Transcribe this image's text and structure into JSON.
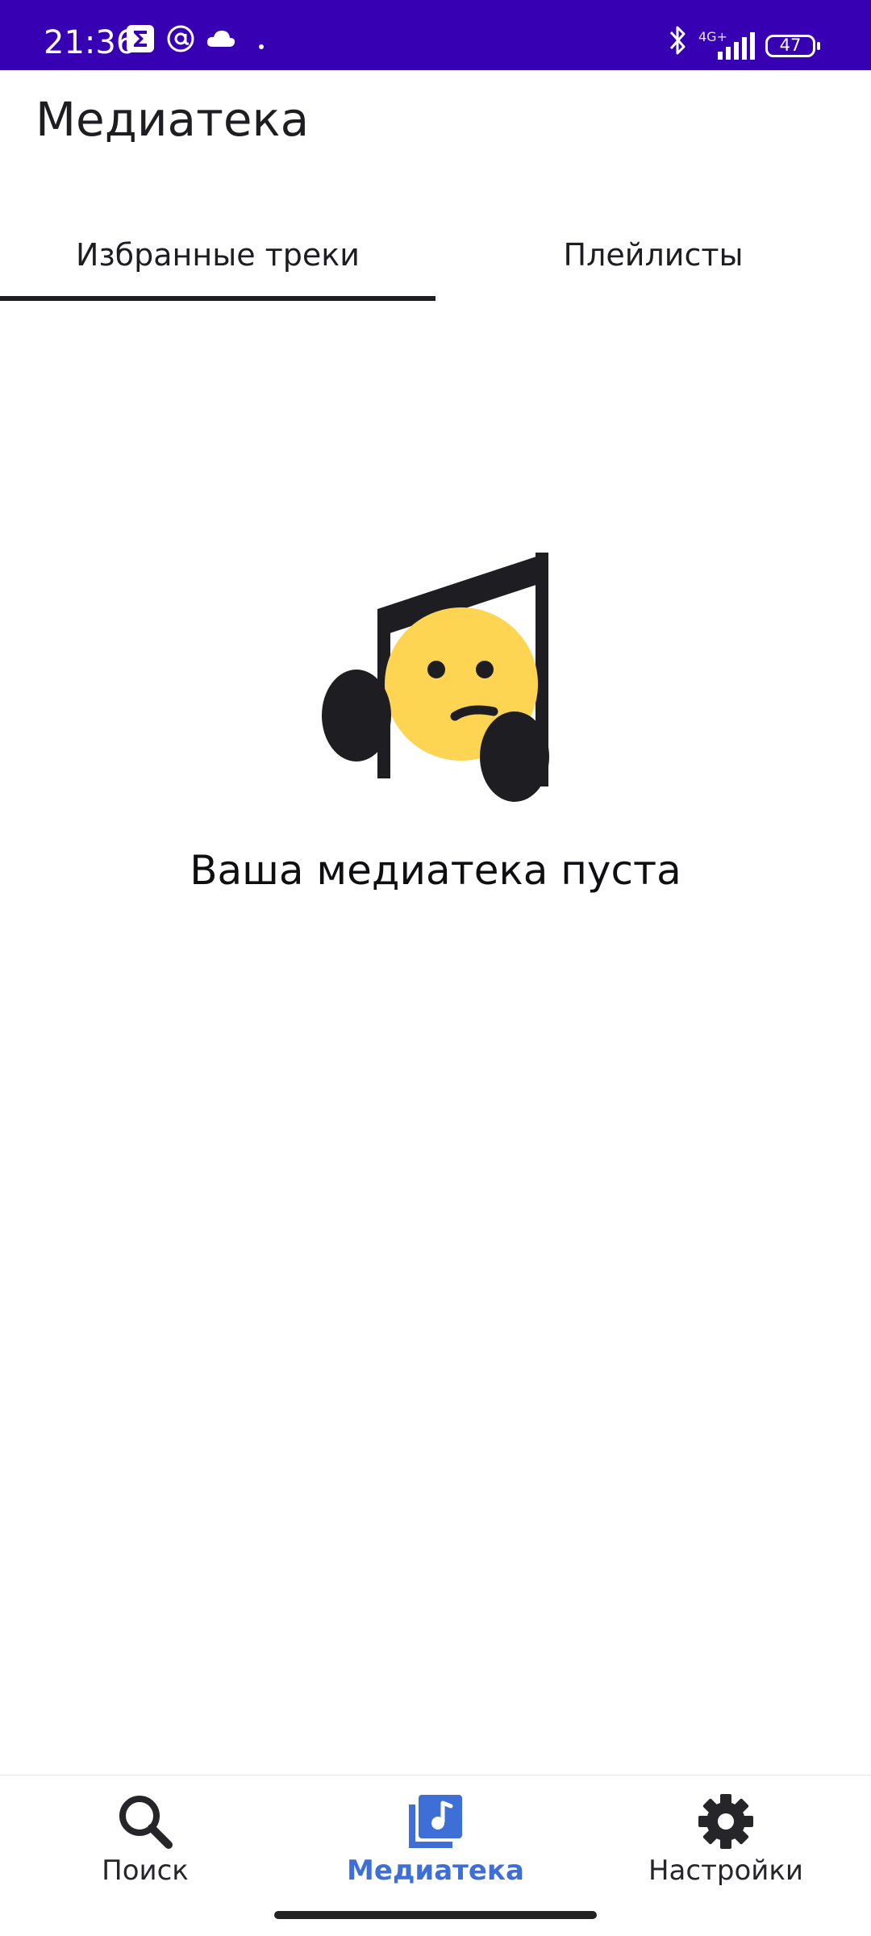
{
  "status_bar": {
    "time": "21:36",
    "network": "4G+",
    "battery": "47",
    "icons": [
      "sigma-app-icon",
      "at-sign-icon",
      "cloud-icon",
      "dot-icon",
      "bluetooth-icon",
      "signal-icon",
      "battery-icon"
    ]
  },
  "header": {
    "title": "Медиатека"
  },
  "tabs": [
    {
      "label": "Избранные треки",
      "active": true
    },
    {
      "label": "Плейлисты",
      "active": false
    }
  ],
  "empty_state": {
    "illustration": "sad-music-note-icon",
    "message": "Ваша медиатека пуста"
  },
  "bottom_nav": {
    "items": [
      {
        "label": "Поиск",
        "icon": "search-icon",
        "active": false
      },
      {
        "label": "Медиатека",
        "icon": "library-music-icon",
        "active": true
      },
      {
        "label": "Настройки",
        "icon": "gear-icon",
        "active": false
      }
    ]
  },
  "colors": {
    "status_bar": "#3700b3",
    "accent": "#3e6fd6",
    "text_dark": "#1d1d22",
    "emoji_yellow": "#fdd553"
  }
}
